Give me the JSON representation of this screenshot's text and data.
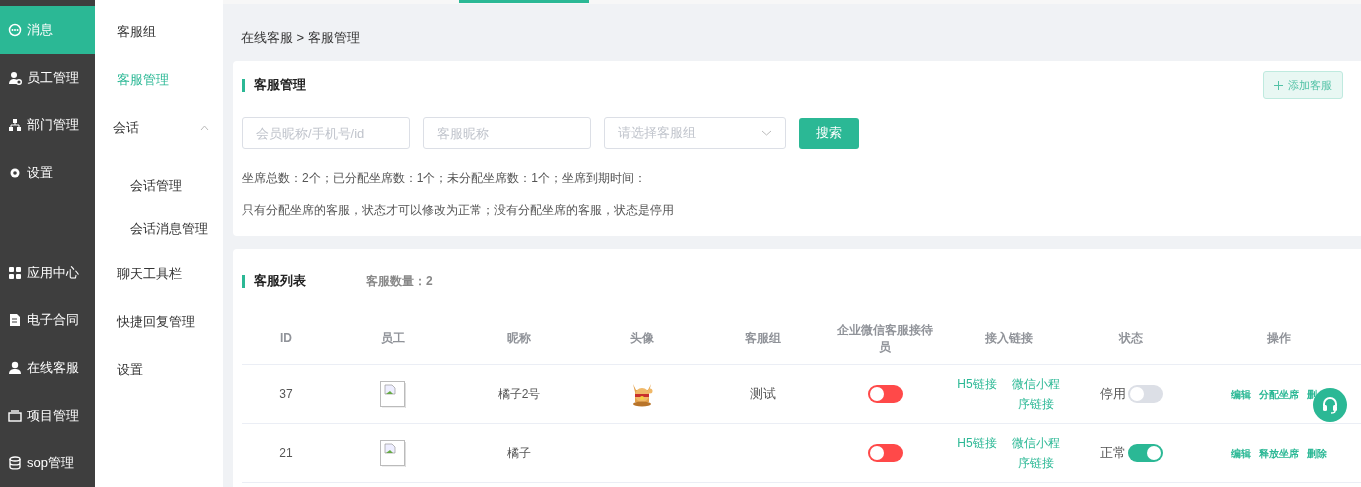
{
  "nav": [
    {
      "label": "消息",
      "selected": true
    },
    {
      "label": "员工管理",
      "selected": false
    },
    {
      "label": "部门管理",
      "selected": false
    },
    {
      "label": "设置",
      "selected": false
    },
    {
      "label": "应用中心",
      "selected": false
    },
    {
      "label": "电子合同",
      "selected": false
    },
    {
      "label": "在线客服",
      "selected": false
    },
    {
      "label": "项目管理",
      "selected": false
    },
    {
      "label": "sop管理",
      "selected": false
    }
  ],
  "submenu": [
    {
      "label": "客服组",
      "selected": false
    },
    {
      "label": "客服管理",
      "selected": true
    },
    {
      "label": "会话",
      "selected": false,
      "expanded": true,
      "children": [
        {
          "label": "会话管理",
          "selected": false
        },
        {
          "label": "会话消息管理",
          "selected": false
        }
      ]
    },
    {
      "label": "聊天工具栏",
      "selected": false
    },
    {
      "label": "快捷回复管理",
      "selected": false
    },
    {
      "label": "设置",
      "selected": false
    }
  ],
  "breadcrumb": "在线客服 > 客服管理",
  "filter_card": {
    "title": "客服管理",
    "add_button": "添加客服",
    "fields": [
      {
        "kind": "input",
        "placeholder": "会员昵称/手机号/id"
      },
      {
        "kind": "input",
        "placeholder": "客服昵称"
      },
      {
        "kind": "select",
        "placeholder": "请选择客服组"
      }
    ],
    "search_button": "搜索",
    "notes": [
      "坐席总数：2个；已分配坐席数：1个；未分配坐席数：1个；坐席到期时间：",
      "只有分配坐席的客服，状态才可以修改为正常；没有分配坐席的客服，状态是停用"
    ]
  },
  "list_card": {
    "title": "客服列表",
    "count": "客服数量：2",
    "table": {
      "columns": [
        "ID",
        "员工",
        "昵称",
        "头像",
        "客服组",
        "企业微信客服接待员",
        "接入链接",
        "状态",
        "操作"
      ],
      "rows": [
        {
          "id": "37",
          "nickname": "橘子2号",
          "avatar": {
            "kind": "picture"
          },
          "group": "测试",
          "wecom": false,
          "links": [
            "H5链接",
            "微信小程序链接"
          ],
          "status": "停用",
          "status_on": false,
          "actions": [
            "编辑",
            "分配坐席",
            "删"
          ]
        },
        {
          "id": "21",
          "nickname": "橘子",
          "wecom": false,
          "links": [
            "H5链接",
            "微信小程序链接"
          ],
          "status": "正常",
          "status_on": true,
          "actions": [
            "编辑",
            "释放坐席",
            "删除"
          ]
        }
      ]
    }
  }
}
